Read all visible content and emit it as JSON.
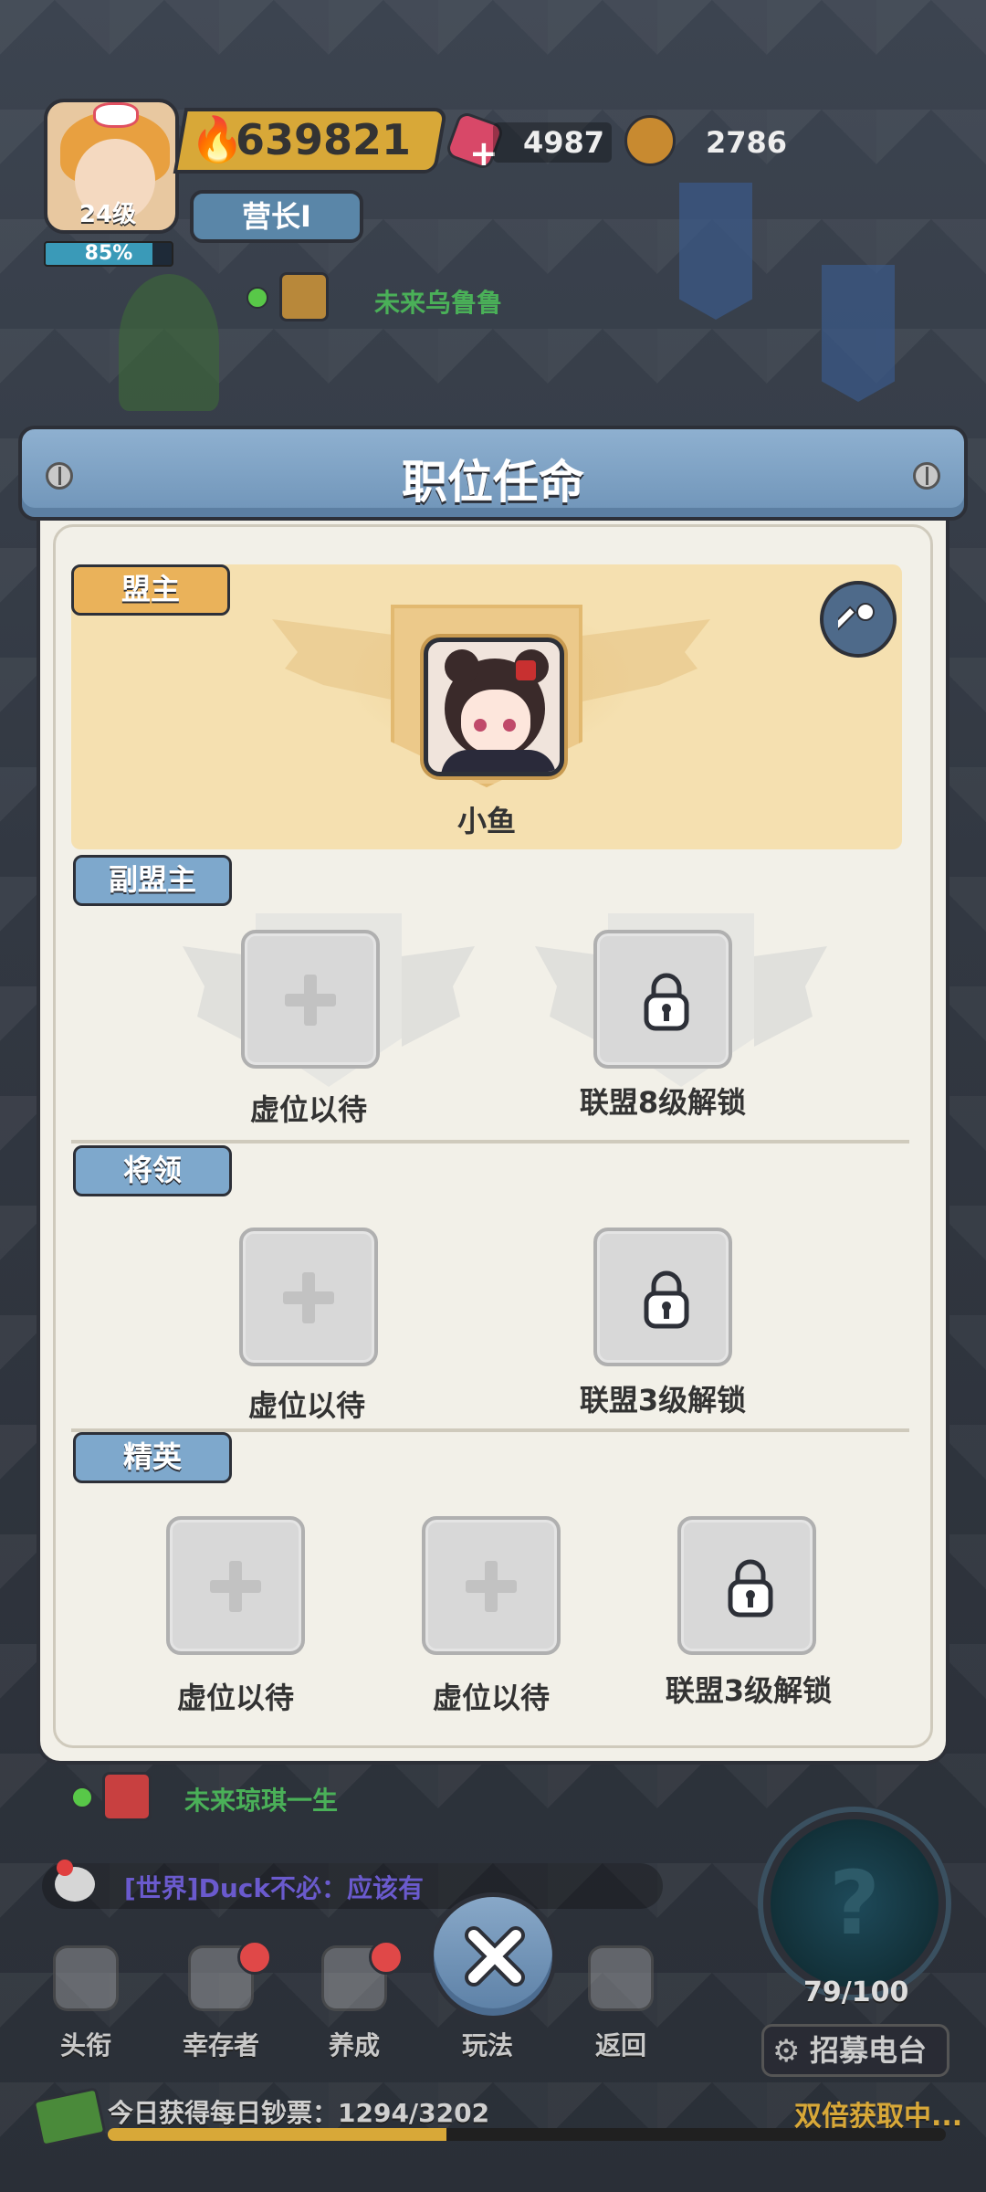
{
  "hud": {
    "level": "24级",
    "exp_percent_text": "85%",
    "exp_fraction": 0.85,
    "power": "639821",
    "title": "营长Ⅰ",
    "gems": "4987",
    "coins": "2786",
    "nearby_player": "未来乌鲁鲁"
  },
  "modal": {
    "title": "职位任命",
    "leader_section": {
      "tag": "盟主",
      "name": "小鱼"
    },
    "deputy_section": {
      "tag": "副盟主",
      "slots": [
        {
          "state": "empty",
          "label": "虚位以待"
        },
        {
          "state": "locked",
          "label": "联盟8级解锁"
        }
      ]
    },
    "general_section": {
      "tag": "将领",
      "slots": [
        {
          "state": "empty",
          "label": "虚位以待"
        },
        {
          "state": "locked",
          "label": "联盟3级解锁"
        }
      ]
    },
    "elite_section": {
      "tag": "精英",
      "slots": [
        {
          "state": "empty",
          "label": "虚位以待"
        },
        {
          "state": "empty",
          "label": "虚位以待"
        },
        {
          "state": "locked",
          "label": "联盟3级解锁"
        }
      ]
    }
  },
  "bottom": {
    "other_player": "未来琼琪一生",
    "chat_message": "[世界]Duck不必：应该有",
    "nav": [
      "头衔",
      "幸存者",
      "养成",
      "玩法",
      "返回"
    ],
    "radar_count": "79/100",
    "recruit_label": "招募电台",
    "tickets_text": "今日获得每日钞票：1294/3202",
    "tickets_fraction": 0.404,
    "double_text": "双倍获取中..."
  },
  "colors": {
    "tag_gold": "#eab25a",
    "tag_blue": "#7ea8cc",
    "leader_card": "#f5e0b0",
    "modal_bg": "#f2f0e8",
    "online_green": "#58c848"
  }
}
